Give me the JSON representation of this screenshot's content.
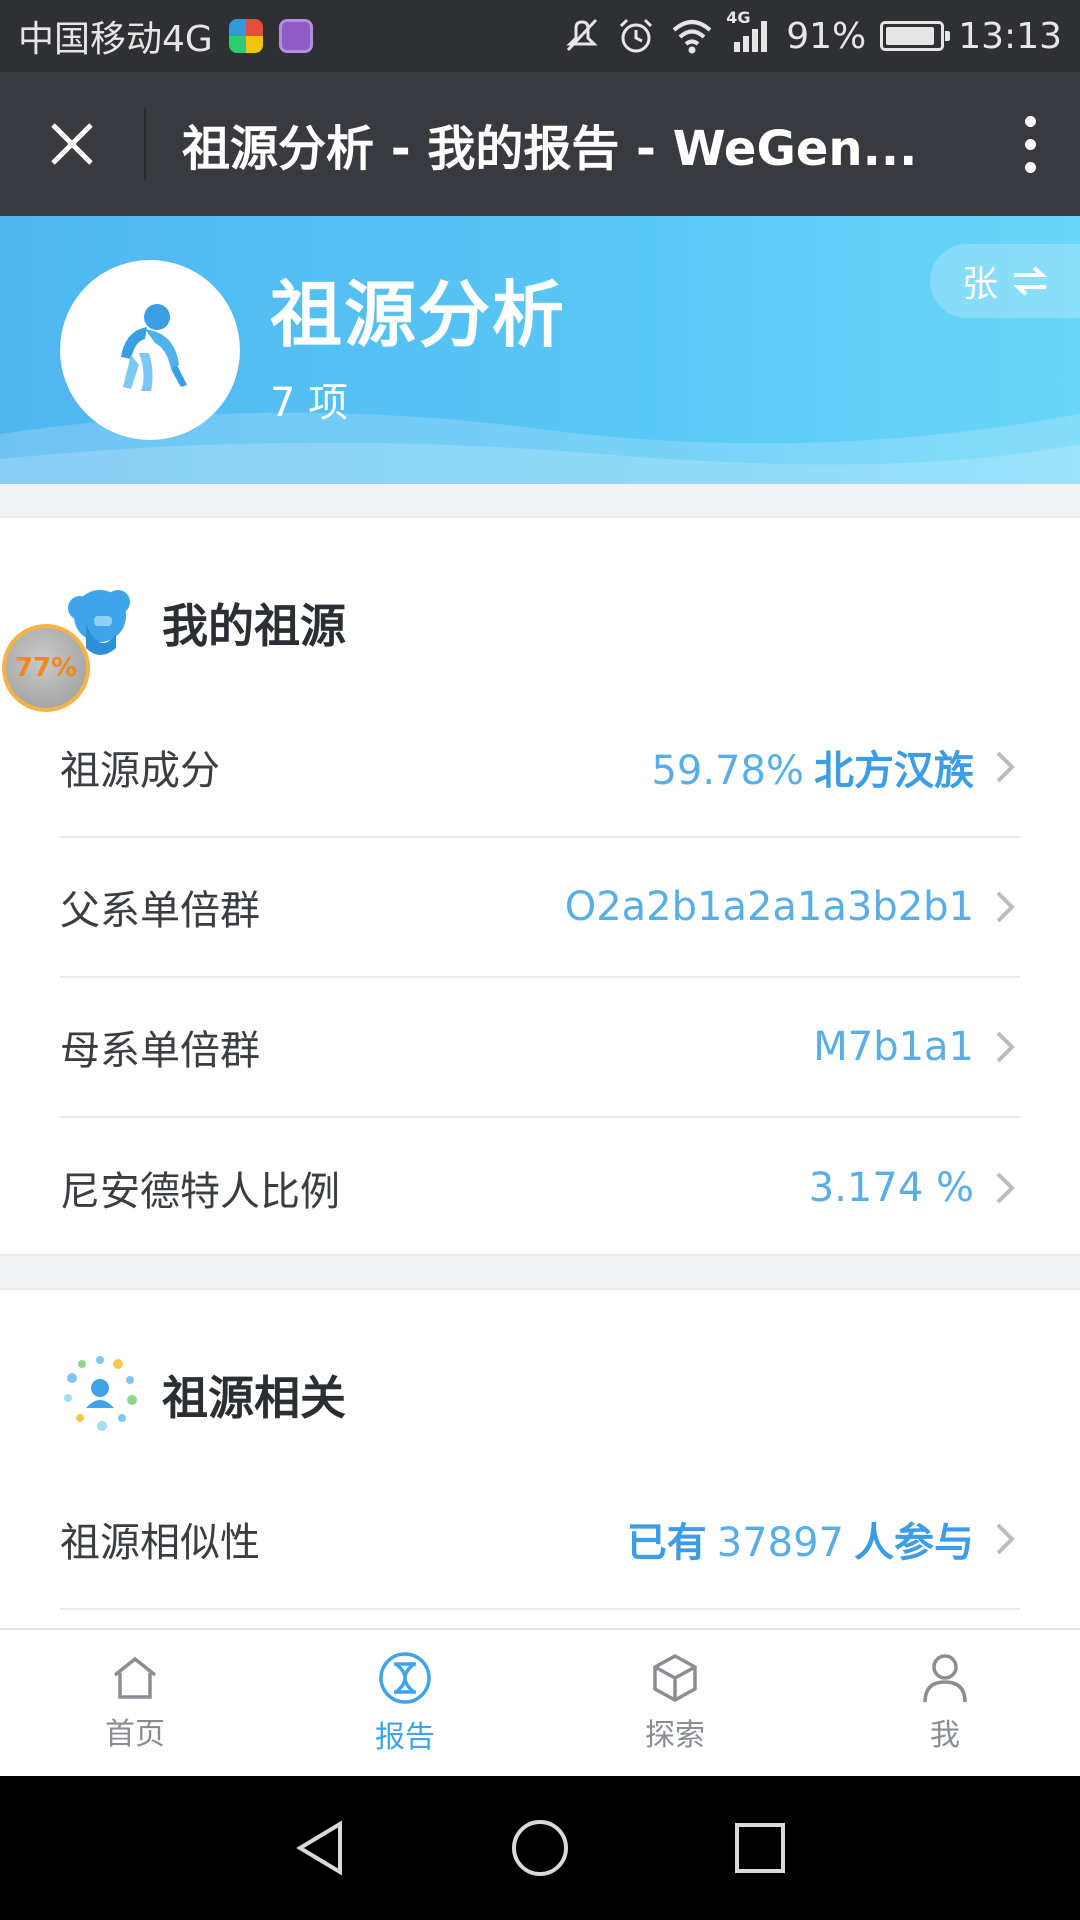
{
  "status_bar": {
    "carrier": "中国移动4G",
    "network_badge": "4G",
    "battery_percent": "91%",
    "battery_level": 0.91,
    "time": "13:13",
    "icons": [
      "app-badge-icon",
      "gallery-icon",
      "mute-icon",
      "alarm-icon",
      "wifi-icon",
      "signal-icon",
      "battery-icon"
    ]
  },
  "title_bar": {
    "title": "祖源分析 - 我的报告 - WeGen...",
    "close_icon": "close-icon",
    "more_icon": "more-vertical-icon"
  },
  "hero": {
    "title": "祖源分析",
    "count": "7 项",
    "user_switch_label": "张",
    "user_switch_icon": "swap-arrows-icon",
    "avatar_icon": "ape-icon",
    "accent": "#4fb6f0"
  },
  "floating_badge": {
    "label": "77%"
  },
  "section_ancestry": {
    "title": "我的祖源",
    "icon": "ancestor-head-icon",
    "rows": [
      {
        "label": "祖源成分",
        "value_number": "59.78%",
        "value_text": "北方汉族"
      },
      {
        "label": "父系单倍群",
        "value_number": "O2a2b1a2a1a3b2b1",
        "value_text": ""
      },
      {
        "label": "母系单倍群",
        "value_number": "M7b1a1",
        "value_text": ""
      },
      {
        "label": "尼安德特人比例",
        "value_number": "3.174 %",
        "value_text": ""
      }
    ]
  },
  "section_related": {
    "title": "祖源相关",
    "icon": "network-people-icon",
    "rows": [
      {
        "prefix": "已有",
        "label": "祖源相似性",
        "value_number": "37897",
        "value_text": "人参与"
      }
    ]
  },
  "tab_bar": {
    "tabs": [
      {
        "label": "首页",
        "icon": "home-icon",
        "active": false
      },
      {
        "label": "报告",
        "icon": "dna-report-icon",
        "active": true
      },
      {
        "label": "探索",
        "icon": "cube-icon",
        "active": false
      },
      {
        "label": "我",
        "icon": "person-icon",
        "active": false
      }
    ],
    "active_color": "#3fa4ea"
  },
  "nav_bar": {
    "buttons": [
      "back-triangle-icon",
      "home-circle-icon",
      "recents-square-icon"
    ]
  }
}
